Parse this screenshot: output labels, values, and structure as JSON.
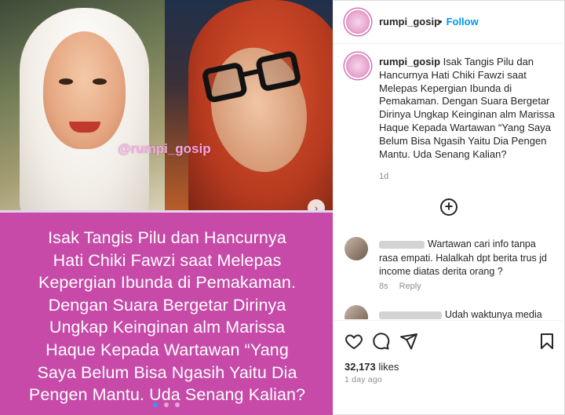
{
  "media": {
    "watermark": "@rumpi_gosip",
    "caption_lines": [
      "Isak Tangis Pilu dan Hancurnya",
      "Hati Chiki Fawzi saat Melepas",
      "Kepergian Ibunda di Pemakaman.",
      "Dengan Suara Bergetar Dirinya",
      "Ungkap Keinginan alm Marissa",
      "Haque Kepada Wartawan “Yang",
      "Saya Belum Bisa Ngasih Yaitu Dia",
      "Pengen Mantu. Uda Senang Kalian?"
    ],
    "next_icon": "chevron-right-icon",
    "slide_count": 3,
    "active_slide": 0
  },
  "header": {
    "username": "rumpi_gosip",
    "separator": "•",
    "follow_label": "Follow"
  },
  "caption": {
    "username": "rumpi_gosip",
    "text": "Isak Tangis Pilu dan Hancurnya Hati Chiki Fawzi saat Melepas Kepergian Ibunda di Pemakaman. Dengan Suara Bergetar Dirinya Ungkap Keinginan alm Marissa Haque Kepada Wartawan “Yang Saya Belum Bisa Ngasih Yaitu Dia Pengen Mantu. Uda Senang Kalian?",
    "time": "1d"
  },
  "comments": [
    {
      "text": "Wartawan cari info tanpa rasa empati. Halalkah dpt berita trus jd income diatas derita orang ?",
      "time": "8s",
      "reply_label": "Reply"
    },
    {
      "text": "Udah waktunya media"
    }
  ],
  "actions": {
    "likes_count": "32,173",
    "likes_label": "likes",
    "posted_ago": "1 day ago"
  },
  "colors": {
    "caption_panel": "#c74aa8",
    "follow": "#0095f6",
    "watermark": "#f6a7e4"
  }
}
